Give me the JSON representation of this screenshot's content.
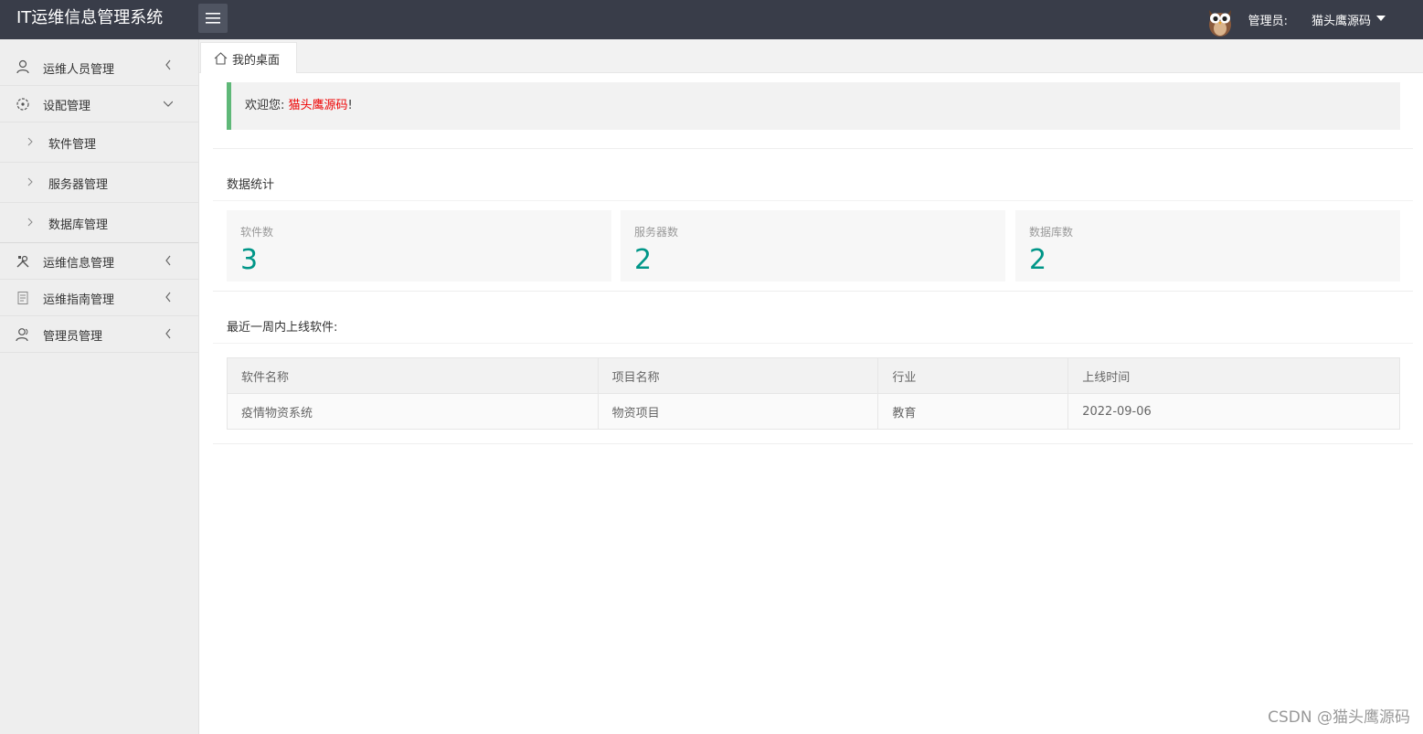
{
  "header": {
    "title": "IT运维信息管理系统",
    "admin_label": "管理员:",
    "admin_name": "猫头鹰源码"
  },
  "sidebar": {
    "items": [
      {
        "label": "运维人员管理",
        "icon": "user-icon",
        "expanded": false
      },
      {
        "label": "设配管理",
        "icon": "settings-icon",
        "expanded": true,
        "children": [
          {
            "label": "软件管理"
          },
          {
            "label": "服务器管理"
          },
          {
            "label": "数据库管理"
          }
        ]
      },
      {
        "label": "运维信息管理",
        "icon": "tools-icon",
        "expanded": false
      },
      {
        "label": "运维指南管理",
        "icon": "document-icon",
        "expanded": false
      },
      {
        "label": "管理员管理",
        "icon": "users-icon",
        "expanded": false
      }
    ]
  },
  "tabs": [
    {
      "label": "我的桌面",
      "icon": "home-icon"
    }
  ],
  "welcome": {
    "prefix": "欢迎您:",
    "user": "猫头鹰源码",
    "suffix": "!"
  },
  "stats": {
    "title": "数据统计",
    "items": [
      {
        "label": "软件数",
        "value": "3"
      },
      {
        "label": "服务器数",
        "value": "2"
      },
      {
        "label": "数据库数",
        "value": "2"
      }
    ]
  },
  "recent": {
    "title": "最近一周内上线软件:",
    "columns": [
      "软件名称",
      "项目名称",
      "行业",
      "上线时间"
    ],
    "rows": [
      [
        "疫情物资系统",
        "物资项目",
        "教育",
        "2022-09-06"
      ]
    ]
  },
  "watermark": "CSDN @猫头鹰源码",
  "colors": {
    "header_bg": "#393d49",
    "accent_green": "#5fb878",
    "stat_value": "#009688",
    "user_red": "#e00000"
  }
}
